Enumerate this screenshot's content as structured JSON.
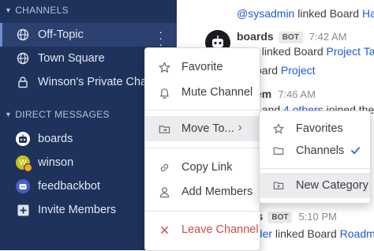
{
  "sidebar": {
    "channels_header": "CHANNELS",
    "channels": [
      {
        "label": "Off-Topic"
      },
      {
        "label": "Town Square"
      },
      {
        "label": "Winson's Private Channel"
      }
    ],
    "dm_header": "DIRECT MESSAGES",
    "dms": [
      {
        "label": "boards"
      },
      {
        "label": "winson",
        "initial": "W"
      },
      {
        "label": "feedbackbot"
      }
    ],
    "invite_label": "Invite Members"
  },
  "messages": {
    "line1_mention": "@sysadmin",
    "line1_text": " linked Board ",
    "line1_board": "Hars",
    "post_author": "boards",
    "bot_badge": "BOT",
    "post_time": "7:42 AM",
    "line2_text": "t linked Board ",
    "line2_board": "Project Ta",
    "line3_text": "oard ",
    "line3_board": "Project",
    "line4_author": "em",
    "line4_time": "7:46 AM",
    "line5_a": "t",
    "line5_b": " and ",
    "line5_c": "4 others",
    "line5_d": " joined the",
    "post2_author": "ds",
    "post2_badge": "BOT",
    "post2_time": "5:10 PM",
    "line6_user": "uder",
    "line6_text": " linked Board ",
    "line6_board": "Roadm"
  },
  "context_menu": {
    "items": [
      {
        "label": "Favorite",
        "icon": "star-icon"
      },
      {
        "label": "Mute Channel",
        "icon": "bell-icon"
      },
      {
        "label": "Move To...",
        "icon": "move-icon",
        "arrow": "›"
      },
      {
        "label": "Copy Link",
        "icon": "link-icon"
      },
      {
        "label": "Add Members",
        "icon": "person-icon"
      },
      {
        "label": "Leave Channel",
        "icon": "close-icon"
      }
    ]
  },
  "submenu": {
    "items": [
      {
        "label": "Favorites",
        "icon": "star-icon"
      },
      {
        "label": "Channels",
        "icon": "folder-icon",
        "checked": true
      },
      {
        "label": "New Category",
        "icon": "new-folder-icon"
      }
    ]
  },
  "colors": {
    "sidebar_bg": "#1e325c",
    "active_item_bg": "#2c4170",
    "link": "#1c58d9",
    "danger": "#d24b4e",
    "check": "#1c58d9"
  }
}
